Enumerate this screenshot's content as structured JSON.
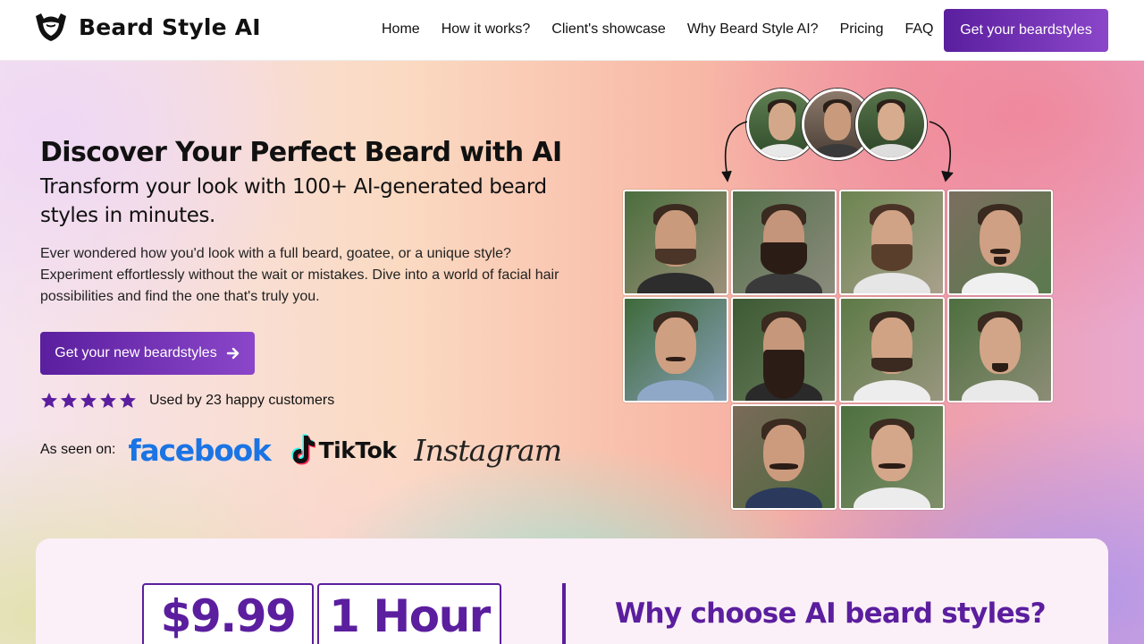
{
  "brand": {
    "name": "Beard Style AI",
    "accent": "#5b1e9e"
  },
  "nav": {
    "items": [
      {
        "label": "Home"
      },
      {
        "label": "How it works?"
      },
      {
        "label": "Client's showcase"
      },
      {
        "label": "Why Beard Style AI?"
      },
      {
        "label": "Pricing"
      },
      {
        "label": "FAQ"
      }
    ],
    "cta_label": "Get your beardstyles"
  },
  "hero": {
    "title": "Discover Your Perfect Beard with AI",
    "subtitle": "Transform your look with 100+ AI-generated beard styles in minutes.",
    "description": "Ever wondered how you'd look with a full beard, goatee, or a unique style? Experiment effortlessly without the wait or mistakes. Dive into a world of facial hair possibilities and find the one that's truly you.",
    "cta_label": "Get your new beardstyles",
    "rating_stars": 5,
    "rating_text": "Used by 23 happy customers",
    "seen_on_label": "As seen on:",
    "seen_on": [
      "facebook",
      "TikTok",
      "Instagram"
    ]
  },
  "stats": {
    "price": "$9.99",
    "time": "1 Hour",
    "why_title": "Why choose AI beard styles?"
  }
}
